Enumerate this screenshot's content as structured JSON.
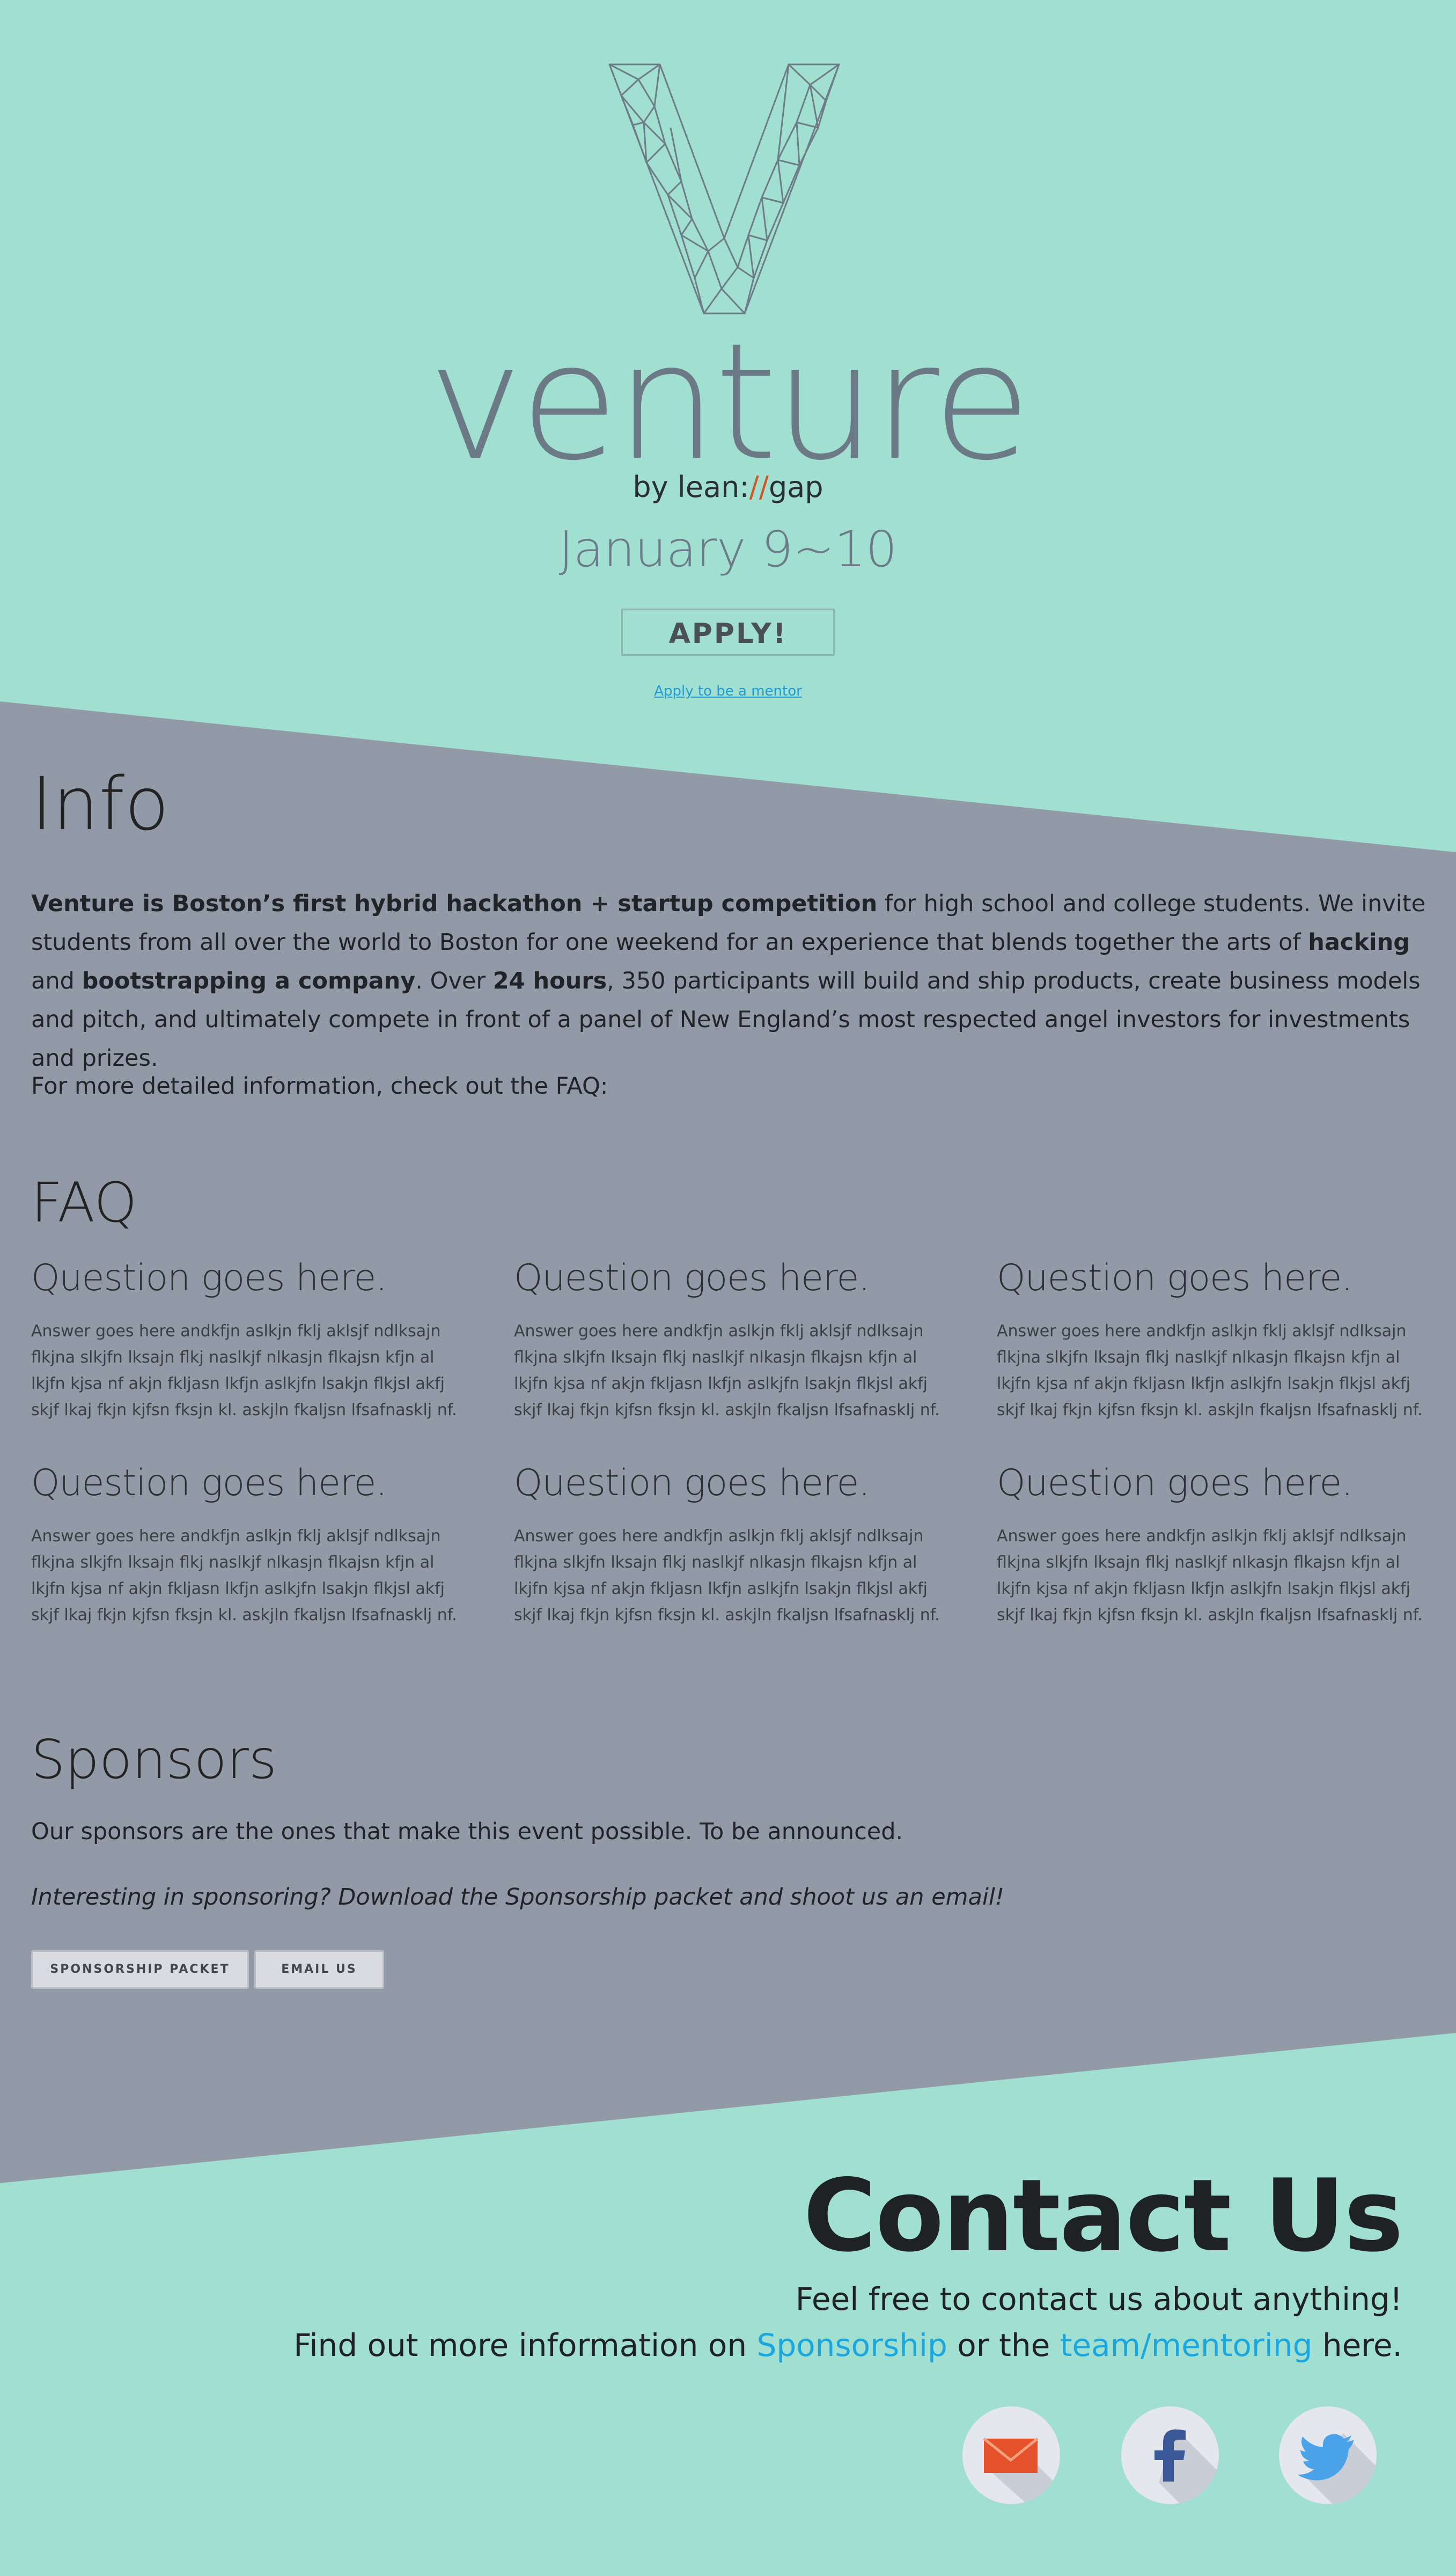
{
  "hero": {
    "brand": "venture",
    "byline_prefix": "by lean",
    "byline_slashes": "//",
    "byline_suffix": "gap",
    "byline_colon": ":",
    "dates": "January 9~10",
    "apply_label": "APPLY!",
    "mentor_link": "Apply to be a mentor"
  },
  "info": {
    "heading": "Info",
    "p1_bold1": "Venture is Boston’s first hybrid hackathon + startup competition",
    "p1_text1": " for high school and college students. We invite students from all over the world to Boston for one weekend for an experience that blends together the arts of ",
    "p1_bold2": "hacking",
    "p1_text2": " and ",
    "p1_bold3": "bootstrapping a company",
    "p1_text3": ". Over ",
    "p1_bold4": "24 hours",
    "p1_text4": ", 350 participants will build and ship products, create business models and pitch, and ultimately compete in front of a panel of New England’s most respected angel investors for investments and prizes.",
    "p2": "For more detailed information, check out the FAQ:"
  },
  "faq": {
    "heading": "FAQ",
    "items": [
      {
        "question": "Question goes here.",
        "answer": "Answer goes here andkfjn aslkjn fklj aklsjf ndlksajn flkjna slkjfn lksajn flkj naslkjf nlkasjn flkajsn kfjn al lkjfn kjsa nf akjn fkljasn lkfjn aslkjfn lsakjn flkjsl akfj skjf lkaj fkjn kjfsn fksjn kl. askjln fkaljsn lfsafnasklj nf."
      },
      {
        "question": "Question goes here.",
        "answer": "Answer goes here andkfjn aslkjn fklj aklsjf ndlksajn flkjna slkjfn lksajn flkj naslkjf nlkasjn flkajsn kfjn al lkjfn kjsa nf akjn fkljasn lkfjn aslkjfn lsakjn flkjsl akfj skjf lkaj fkjn kjfsn fksjn kl. askjln fkaljsn lfsafnasklj nf."
      },
      {
        "question": "Question goes here.",
        "answer": "Answer goes here andkfjn aslkjn fklj aklsjf ndlksajn flkjna slkjfn lksajn flkj naslkjf nlkasjn flkajsn kfjn al lkjfn kjsa nf akjn fkljasn lkfjn aslkjfn lsakjn flkjsl akfj skjf lkaj fkjn kjfsn fksjn kl. askjln fkaljsn lfsafnasklj nf."
      },
      {
        "question": "Question goes here.",
        "answer": "Answer goes here andkfjn aslkjn fklj aklsjf ndlksajn flkjna slkjfn lksajn flkj naslkjf nlkasjn flkajsn kfjn al lkjfn kjsa nf akjn fkljasn lkfjn aslkjfn lsakjn flkjsl akfj skjf lkaj fkjn kjfsn fksjn kl. askjln fkaljsn lfsafnasklj nf."
      },
      {
        "question": "Question goes here.",
        "answer": "Answer goes here andkfjn aslkjn fklj aklsjf ndlksajn flkjna slkjfn lksajn flkj naslkjf nlkasjn flkajsn kfjn al lkjfn kjsa nf akjn fkljasn lkfjn aslkjfn lsakjn flkjsl akfj skjf lkaj fkjn kjfsn fksjn kl. askjln fkaljsn lfsafnasklj nf."
      },
      {
        "question": "Question goes here.",
        "answer": "Answer goes here andkfjn aslkjn fklj aklsjf ndlksajn flkjna slkjfn lksajn flkj naslkjf nlkasjn flkajsn kfjn al lkjfn kjsa nf akjn fkljasn lkfjn aslkjfn lsakjn flkjsl akfj skjf lkaj fkjn kjfsn fksjn kl. askjln fkaljsn lfsafnasklj nf."
      }
    ]
  },
  "sponsors": {
    "heading": "Sponsors",
    "text": "Our sponsors are the ones that make this event possible. To be announced.",
    "italic": "Interesting in sponsoring? Download the Sponsorship packet and shoot us an email!",
    "packet_button": "SPONSORSHIP PACKET",
    "email_button": "EMAIL US"
  },
  "contact": {
    "heading": "Contact Us",
    "line1": "Feel free to contact us about anything!",
    "line2_a": "Find out more information on ",
    "line2_link1": "Sponsorship",
    "line2_b": " or the ",
    "line2_link2": "team/mentoring",
    "line2_c": " here.",
    "icons": [
      "email-icon",
      "facebook-icon",
      "twitter-icon"
    ]
  },
  "colors": {
    "background": "#a1dfd0",
    "wedge": "#919aa6",
    "link": "#1aa7df",
    "brand": "#6b7a86"
  }
}
